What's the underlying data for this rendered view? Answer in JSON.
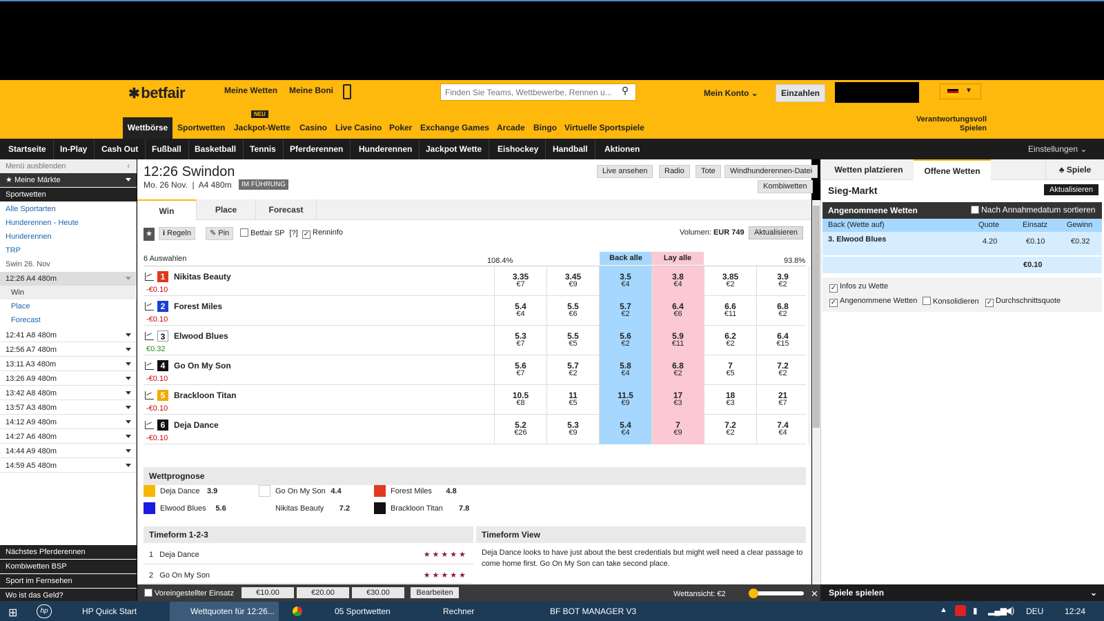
{
  "header": {
    "logo": "betfair",
    "meine_wetten": "Meine Wetten",
    "meine_boni": "Meine Boni",
    "search_placeholder": "Finden Sie Teams, Wettbewerbe, Rennen u...",
    "mein_konto": "Mein Konto",
    "einzahlen": "Einzahlen",
    "neu_badge": "NEU",
    "verantwortung_1": "Verantwortungsvoll",
    "verantwortung_2": "Spielen",
    "products": [
      "Wettbörse",
      "Sportwetten",
      "Jackpot-Wette",
      "Casino",
      "Live Casino",
      "Poker",
      "Exchange Games",
      "Arcade",
      "Bingo",
      "Virtuelle Sportspiele"
    ]
  },
  "sportnav": {
    "items": [
      "Startseite",
      "In-Play",
      "Cash Out",
      "Fußball",
      "Basketball",
      "Tennis",
      "Pferderennen",
      "Hunderennen",
      "Jackpot Wette",
      "Eishockey",
      "Handball",
      "Aktionen"
    ],
    "einstellungen": "Einstellungen"
  },
  "sidebar": {
    "hide_menu": "Menü ausblenden",
    "meine_maerkte": "Meine Märkte",
    "sportwetten": "Sportwetten",
    "links": [
      "Alle Sportarten",
      "Hunderennen - Heute",
      "Hunderennen",
      "TRP"
    ],
    "venue": "Swin 26. Nov",
    "current_race": "12:26 A4 480m",
    "markets": [
      "Win",
      "Place",
      "Forecast"
    ],
    "races": [
      "12:41 A8 480m",
      "12:56 A7 480m",
      "13:11 A3 480m",
      "13:26 A9 480m",
      "13:42 A8 480m",
      "13:57 A3 480m",
      "14:12 A9 480m",
      "14:27 A6 480m",
      "14:44 A9 480m",
      "14:59 A5 480m"
    ],
    "footer": [
      "Nächstes Pferderennen",
      "Kombiwetten BSP",
      "Sport im Fernsehen",
      "Wo ist das Geld?"
    ]
  },
  "race": {
    "title": "12:26 Swindon",
    "date": "Mo. 26 Nov.",
    "info": "A4 480m",
    "status": "IM FÜHRUNG",
    "buttons": [
      "Live ansehen",
      "Radio",
      "Tote",
      "Windhunderennen-Datei"
    ],
    "kombiwetten": "Kombiwetten",
    "tabs": [
      "Win",
      "Place",
      "Forecast"
    ],
    "tools": {
      "regeln": "Regeln",
      "pin": "Pin",
      "bsp": "Betfair SP",
      "bsp_help": "[?]",
      "renninfo": "Renninfo"
    },
    "volumen_label": "Volumen:",
    "volumen_value": "EUR 749",
    "aktualisieren": "Aktualisieren",
    "auswahlen": "6 Auswahlen",
    "back_pct": "108.4%",
    "lay_pct": "93.8%",
    "back_alle": "Back alle",
    "lay_alle": "Lay alle"
  },
  "runners": [
    {
      "num": "1",
      "name": "Nikitas Beauty",
      "pl": "-€0.10",
      "color": "#e03a1e",
      "odds": [
        [
          "3.35",
          "€7"
        ],
        [
          "3.45",
          "€9"
        ],
        [
          "3.5",
          "€4"
        ],
        [
          "3.8",
          "€4"
        ],
        [
          "3.85",
          "€2"
        ],
        [
          "3.9",
          "€2"
        ]
      ]
    },
    {
      "num": "2",
      "name": "Forest Miles",
      "pl": "-€0.10",
      "color": "#1a3fd6",
      "odds": [
        [
          "5.4",
          "€4"
        ],
        [
          "5.5",
          "€6"
        ],
        [
          "5.7",
          "€2"
        ],
        [
          "6.4",
          "€6"
        ],
        [
          "6.6",
          "€11"
        ],
        [
          "6.8",
          "€2"
        ]
      ]
    },
    {
      "num": "3",
      "name": "Elwood Blues",
      "pl": "€0.32",
      "color": "#ffffff",
      "odds": [
        [
          "5.3",
          "€7"
        ],
        [
          "5.5",
          "€5"
        ],
        [
          "5.6",
          "€2"
        ],
        [
          "5.9",
          "€11"
        ],
        [
          "6.2",
          "€2"
        ],
        [
          "6.4",
          "€15"
        ]
      ]
    },
    {
      "num": "4",
      "name": "Go On My Son",
      "pl": "-€0.10",
      "color": "#111111",
      "odds": [
        [
          "5.6",
          "€7"
        ],
        [
          "5.7",
          "€2"
        ],
        [
          "5.8",
          "€4"
        ],
        [
          "6.8",
          "€2"
        ],
        [
          "7",
          "€5"
        ],
        [
          "7.2",
          "€2"
        ]
      ]
    },
    {
      "num": "5",
      "name": "Brackloon Titan",
      "pl": "-€0.10",
      "color": "#f2a900",
      "odds": [
        [
          "10.5",
          "€8"
        ],
        [
          "11",
          "€5"
        ],
        [
          "11.5",
          "€9"
        ],
        [
          "17",
          "€3"
        ],
        [
          "18",
          "€3"
        ],
        [
          "21",
          "€7"
        ]
      ]
    },
    {
      "num": "6",
      "name": "Deja Dance",
      "pl": "-€0.10",
      "color": "#111111",
      "odds": [
        [
          "5.2",
          "€26"
        ],
        [
          "5.3",
          "€9"
        ],
        [
          "5.4",
          "€4"
        ],
        [
          "7",
          "€9"
        ],
        [
          "7.2",
          "€2"
        ],
        [
          "7.4",
          "€4"
        ]
      ]
    }
  ],
  "prognose": {
    "title": "Wettprognose",
    "items": [
      {
        "name": "Deja Dance",
        "value": "3.9",
        "color": "#f5b800"
      },
      {
        "name": "Go On My Son",
        "value": "4.4",
        "color": "#ffffff"
      },
      {
        "name": "Forest Miles",
        "value": "4.8",
        "color": "#e03a1e"
      },
      {
        "name": "Elwood Blues",
        "value": "5.6",
        "color": "#1a1ae0"
      },
      {
        "name": "Nikitas Beauty",
        "value": "7.2",
        "color": ""
      },
      {
        "name": "Brackloon Titan",
        "value": "7.8",
        "color": "#111111"
      }
    ]
  },
  "timeform": {
    "title_123": "Timeform 1-2-3",
    "rows": [
      {
        "pos": "1",
        "name": "Deja Dance",
        "stars": "★★★★★"
      },
      {
        "pos": "2",
        "name": "Go On My Son",
        "stars": "★★★★★"
      }
    ],
    "title_view": "Timeform View",
    "view_text": "Deja Dance looks to have just about the best credentials but might well need a clear passage to come home first. Go On My Son can take second place."
  },
  "stakebar": {
    "label": "Voreingestellter Einsatz",
    "stakes": [
      "€10.00",
      "€20.00",
      "€30.00"
    ],
    "bearbeiten": "Bearbeiten",
    "wettansicht": "Wettansicht:",
    "wettansicht_value": "€2"
  },
  "betslip": {
    "tabs": [
      "Wetten platzieren",
      "Offene Wetten",
      "Spiele"
    ],
    "market": "Sieg-Markt",
    "aktualisieren": "Aktualisieren",
    "accepted": "Angenommene Wetten",
    "sort_label": "Nach Annahmedatum sortieren",
    "cols": [
      "Back (Wette auf)",
      "Quote",
      "Einsatz",
      "Gewinn"
    ],
    "bet": {
      "selection": "3. Elwood Blues",
      "odds": "4.20",
      "stake": "€0.10",
      "profit": "€0.32"
    },
    "total": "€0.10",
    "opts": [
      "Infos zu Wette",
      "Angenommene Wetten",
      "Konsolidieren",
      "Durchschnittsquote"
    ],
    "spiele_spielen": "Spiele spielen"
  },
  "taskbar": {
    "items": [
      "HP Quick Start",
      "Wettquoten für 12:26...",
      "05 Sportwetten",
      "Rechner",
      "BF BOT MANAGER V3"
    ],
    "lang": "DEU",
    "time": "12:24"
  }
}
